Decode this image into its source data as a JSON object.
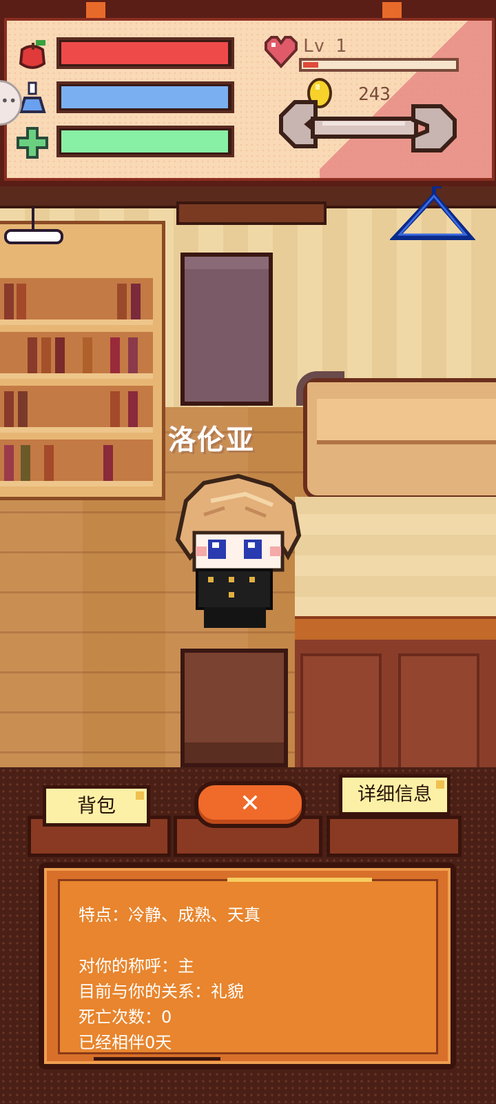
{
  "stats": {
    "hunger": {
      "icon": "apple-icon",
      "color": "#ef4a4a",
      "fill": 0.99
    },
    "water": {
      "icon": "potion-icon",
      "color": "#7ab0f2",
      "fill": 0.99
    },
    "health": {
      "icon": "green-cross-icon",
      "color": "#88f0a4",
      "fill": 0.99
    }
  },
  "level": {
    "label": "Lv 1",
    "xp_fill": 0.1
  },
  "coins": {
    "count": "243"
  },
  "character": {
    "name": "洛伦亚"
  },
  "buttons": {
    "backpack": "背包",
    "close": "✕",
    "details": "详细信息"
  },
  "info": {
    "lines": [
      "特点：冷静、成熟、天真",
      "",
      "对你的称呼：主",
      "目前与你的关系：礼貌",
      "死亡次数：0",
      "已经相伴0天"
    ]
  }
}
